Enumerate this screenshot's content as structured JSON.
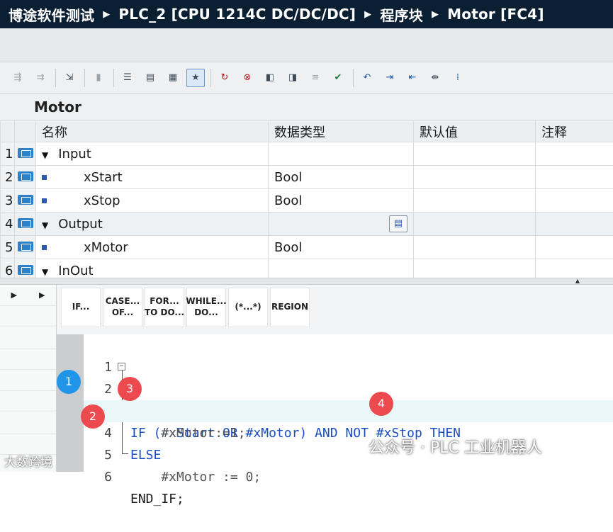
{
  "breadcrumb": [
    "博途软件测试",
    "PLC_2 [CPU 1214C DC/DC/DC]",
    "程序块",
    "Motor [FC4]"
  ],
  "toolbar_icons": [
    "insert-row-icon",
    "add-row-icon",
    "compile-icon",
    "download-icon",
    "monitor-icon",
    "list-icon",
    "block-call-icon",
    "network-icon",
    "favorites-icon",
    "disconnect-icon",
    "stop-icon",
    "watch-icon",
    "force-icon",
    "compare-icon",
    "verify-icon",
    "jump-back-icon",
    "indent-icon",
    "outdent-icon",
    "align-icon",
    "more-icon"
  ],
  "block_name": "Motor",
  "interface": {
    "headers": [
      "名称",
      "数据类型",
      "默认值",
      "注释"
    ],
    "rows": [
      {
        "num": "1",
        "name": "Input",
        "type": "",
        "section": true
      },
      {
        "num": "2",
        "name": "xStart",
        "type": "Bool",
        "section": false
      },
      {
        "num": "3",
        "name": "xStop",
        "type": "Bool",
        "section": false
      },
      {
        "num": "4",
        "name": "Output",
        "type": "",
        "section": true
      },
      {
        "num": "5",
        "name": "xMotor",
        "type": "Bool",
        "section": false
      },
      {
        "num": "6",
        "name": "InOut",
        "type": "",
        "section": true
      }
    ]
  },
  "keywords": [
    "IF...",
    "CASE...\nOF...",
    "FOR...\nTO DO...",
    "WHILE...\nDO...",
    "(*...*)",
    "REGION"
  ],
  "code": {
    "lines": [
      {
        "n": "1",
        "text": ""
      },
      {
        "n": "2",
        "text": "IF (#xStart OR #xMotor) AND NOT #xStop THEN"
      },
      {
        "n": "3",
        "text": "    #xMotor:=1;"
      },
      {
        "n": "4",
        "text": "ELSE"
      },
      {
        "n": "5",
        "text": "    #xMotor := 0;"
      },
      {
        "n": "6",
        "text": "END_IF;"
      }
    ]
  },
  "badges": [
    "1",
    "2",
    "3",
    "4"
  ],
  "watermark": "公众号 · PLC 工业机器人",
  "watermark2": "大数跨境"
}
